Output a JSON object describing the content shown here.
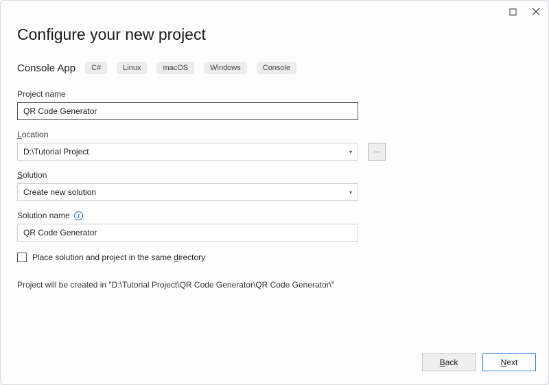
{
  "header": {
    "title": "Configure your new project"
  },
  "template": {
    "name": "Console App",
    "tags": [
      "C#",
      "Linux",
      "macOS",
      "Windows",
      "Console"
    ]
  },
  "fields": {
    "projectName": {
      "label": "Project name",
      "value": "QR Code Generator"
    },
    "location": {
      "label": "Location",
      "value": "D:\\Tutorial Project",
      "browse": "..."
    },
    "solution": {
      "label": "Solution",
      "value": "Create new solution"
    },
    "solutionName": {
      "label": "Solution name",
      "value": "QR Code Generator"
    },
    "sameDir": {
      "label": "Place solution and project in the same directory"
    }
  },
  "hint": "Project will be created in \"D:\\Tutorial Project\\QR Code Generator\\QR Code Generator\\\"",
  "footer": {
    "back": "Back",
    "next": "Next"
  }
}
